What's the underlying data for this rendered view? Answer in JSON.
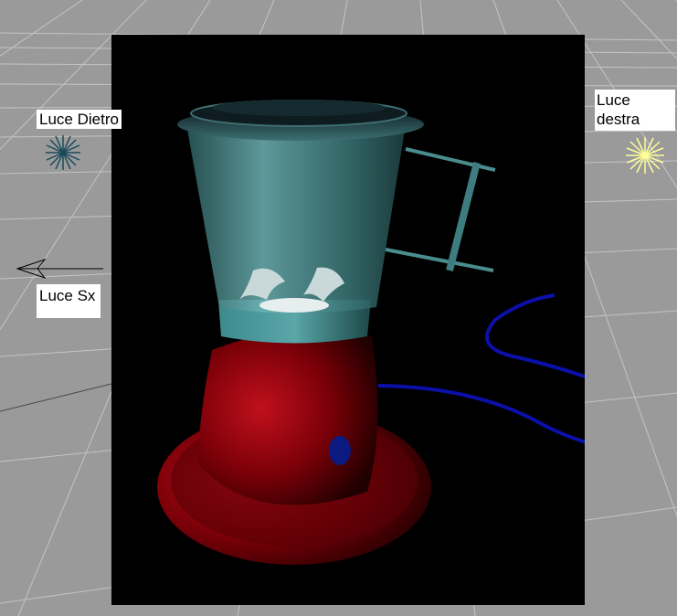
{
  "viewport": {
    "background_color": "#9a9a9a",
    "grid_color": "#c8c8c8",
    "render_background": "#000000"
  },
  "lights": {
    "back": {
      "label": "Luce Dietro",
      "icon": "star-burst-light-icon",
      "color": "#1a4a5a"
    },
    "right": {
      "label": "Luce\ndestra",
      "icon": "star-burst-light-icon",
      "color": "#ffff99"
    },
    "left": {
      "label": "Luce Sx",
      "icon": "directional-light-arrow-icon",
      "color": "#000000"
    }
  },
  "render": {
    "subject": "blender-icon",
    "colors": {
      "jar": "#5fa5a8",
      "base": "#b00010",
      "cord": "#1010a0",
      "blades": "#c0d0d0"
    }
  }
}
